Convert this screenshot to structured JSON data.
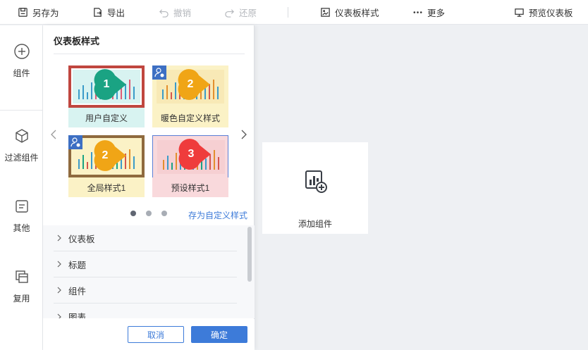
{
  "toolbar": {
    "save_as": "另存为",
    "export": "导出",
    "undo": "撤销",
    "redo": "还原",
    "dashboard_style": "仪表板样式",
    "more": "更多",
    "preview": "预览仪表板"
  },
  "rail": {
    "items": [
      {
        "label": "组件",
        "icon": "plus-circle-icon"
      },
      {
        "label": "过滤组件",
        "icon": "cube-icon"
      },
      {
        "label": "其他",
        "icon": "list-icon"
      },
      {
        "label": "复用",
        "icon": "copy-icon"
      }
    ]
  },
  "panel": {
    "title": "仪表板样式",
    "styles": [
      {
        "label": "用户自定义",
        "badge": "1",
        "theme": "teal",
        "selected_frame": "#c0463f",
        "pin_color": "#1aa383"
      },
      {
        "label": "暖色自定义样式",
        "badge": "2",
        "theme": "warm",
        "pin_color": "#f0a516",
        "user_icon": true
      },
      {
        "label": "全局样式1",
        "badge": "2",
        "theme": "warm-framed",
        "frame": "#8f6a3e",
        "pin_color": "#f0a516",
        "user_icon": true
      },
      {
        "label": "预设样式1",
        "badge": "3",
        "theme": "pink",
        "pin_color": "#ef3c3c",
        "selected": true
      }
    ],
    "pagination": {
      "pages": 3,
      "current": 1
    },
    "save_custom": "存为自定义样式",
    "sections": [
      "仪表板",
      "标题",
      "组件",
      "图表"
    ],
    "cancel": "取消",
    "confirm": "确定"
  },
  "canvas": {
    "add_component": "添加组件"
  },
  "colors": {
    "accent": "#3d7bd9",
    "teal_bg": "#d8f3f1",
    "warm_bg": "#fbf2c6",
    "pink_bg": "#f9d9dc"
  }
}
